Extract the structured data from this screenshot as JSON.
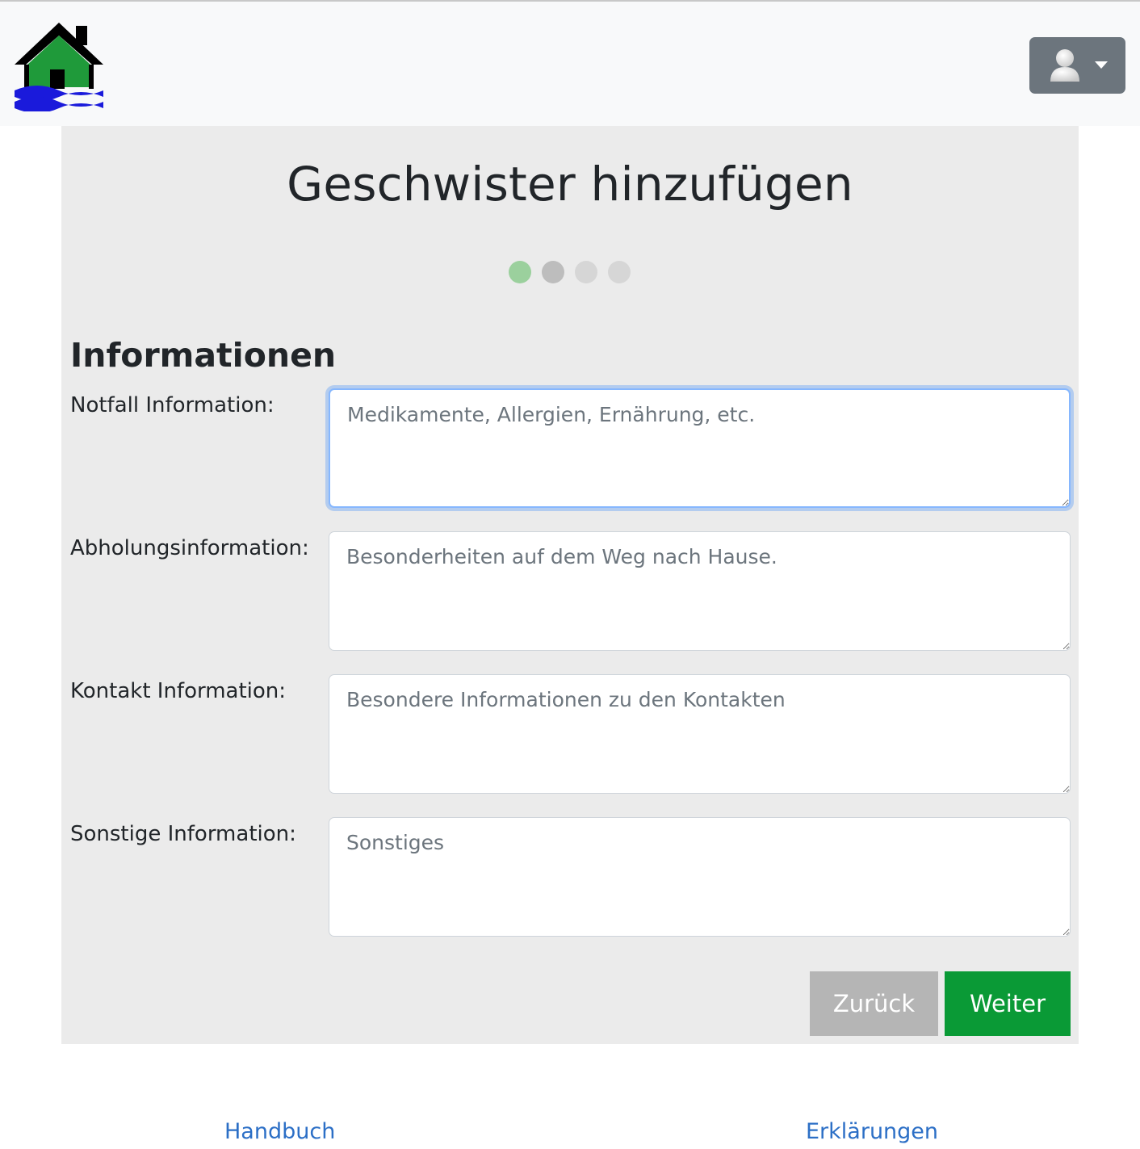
{
  "header": {
    "logo_icon": "house-flood-logo-icon",
    "user_menu_icon": "user-avatar-icon"
  },
  "wizard": {
    "title": "Geschwister hinzufügen",
    "steps": [
      {
        "state": "current",
        "color": "#9bd09d"
      },
      {
        "state": "next",
        "color": "#bdbdbd"
      },
      {
        "state": "pending",
        "color": "#d6d6d6"
      },
      {
        "state": "pending",
        "color": "#d6d6d6"
      }
    ],
    "current_step": 1,
    "total_steps": 4
  },
  "form": {
    "section_title": "Informationen",
    "fields": [
      {
        "label": "Notfall Information:",
        "placeholder": "Medikamente, Allergien, Ernährung, etc.",
        "value": ""
      },
      {
        "label": "Abholungsinformation:",
        "placeholder": "Besonderheiten auf dem Weg nach Hause.",
        "value": ""
      },
      {
        "label": "Kontakt Information:",
        "placeholder": "Besondere Informationen zu den Kontakten",
        "value": ""
      },
      {
        "label": "Sonstige Information:",
        "placeholder": "Sonstiges",
        "value": ""
      }
    ],
    "back_label": "Zurück",
    "next_label": "Weiter"
  },
  "footer": {
    "manual_link": "Handbuch",
    "explanations_link": "Erklärungen"
  },
  "colors": {
    "primary_green": "#0a9a36",
    "back_gray": "#b5b5b5",
    "link_blue": "#2c6fc6",
    "card_bg": "#ebebeb"
  }
}
